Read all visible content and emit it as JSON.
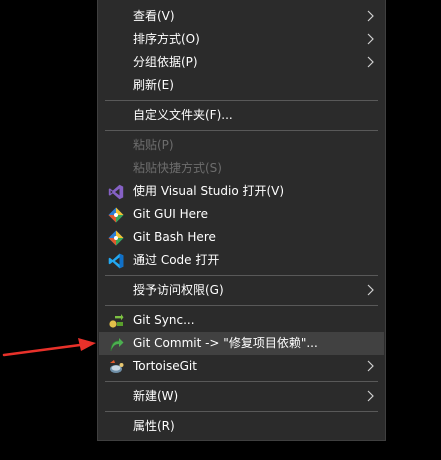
{
  "menu": {
    "view": "查看(V)",
    "sort": "排序方式(O)",
    "group": "分组依据(P)",
    "refresh": "刷新(E)",
    "customize": "自定义文件夹(F)...",
    "paste": "粘贴(P)",
    "paste_shortcut": "粘贴快捷方式(S)",
    "open_vs": "使用 Visual Studio 打开(V)",
    "git_gui": "Git GUI Here",
    "git_bash": "Git Bash Here",
    "open_code": "通过 Code 打开",
    "grant_access": "授予访问权限(G)",
    "git_sync": "Git Sync...",
    "git_commit": "Git Commit -> \"修复项目依赖\"...",
    "tortoisegit": "TortoiseGit",
    "new": "新建(W)",
    "properties": "属性(R)"
  },
  "colors": {
    "menu_bg": "#2b2b2b",
    "hover_bg": "#414141",
    "text": "#ffffff",
    "disabled_text": "#6d6d6d",
    "separator": "#595959",
    "pointer_arrow": "#e8312a"
  },
  "icons": {
    "visual_studio": "visual-studio-icon",
    "git_gui": "git-icon",
    "git_bash": "git-icon",
    "vscode": "vscode-icon",
    "git_sync": "tortoisegit-sync-icon",
    "git_commit": "tortoisegit-commit-icon",
    "tortoisegit": "tortoisegit-icon",
    "submenu_arrow": "chevron-right-icon"
  }
}
